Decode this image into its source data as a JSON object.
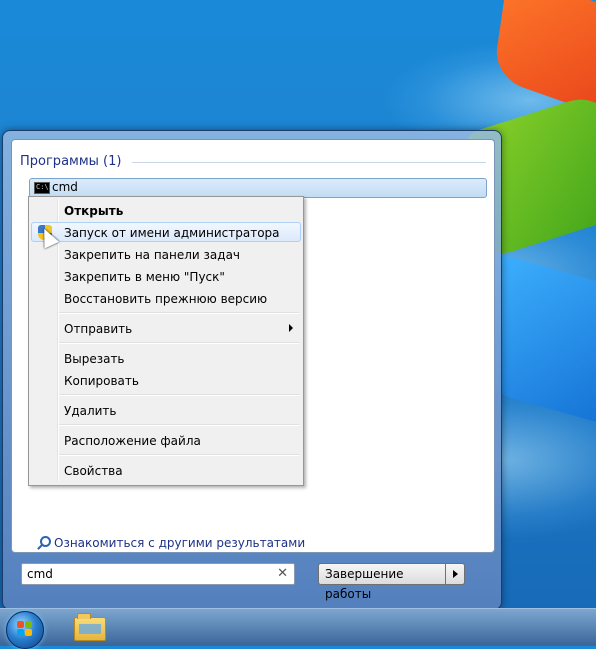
{
  "start_menu": {
    "section_title": "Программы (1)",
    "result": {
      "label": "cmd",
      "icon": "console-icon"
    },
    "more_results_label": "Ознакомиться с другими результатами",
    "search": {
      "value": "cmd",
      "clear_icon": "clear-icon"
    },
    "shutdown_label": "Завершение работы"
  },
  "context_menu": {
    "items": [
      {
        "label": "Открыть",
        "bold": true
      },
      {
        "label": "Запуск от имени администратора",
        "icon": "uac-shield-icon",
        "highlighted": true
      },
      {
        "label": "Закрепить на панели задач"
      },
      {
        "label": "Закрепить в меню \"Пуск\""
      },
      {
        "label": "Восстановить прежнюю версию"
      },
      {
        "label": "Отправить",
        "submenu": true
      },
      {
        "label": "Вырезать"
      },
      {
        "label": "Копировать"
      },
      {
        "label": "Удалить"
      },
      {
        "label": "Расположение файла"
      },
      {
        "label": "Свойства"
      }
    ]
  },
  "taskbar": {
    "start_icon": "windows-start-orb-icon",
    "pinned": [
      {
        "icon": "windows-explorer-folder-icon"
      }
    ]
  },
  "colors": {
    "section_title": "#1e3287",
    "highlight": "#dbe9fb",
    "desktop": "#1f7fcd"
  }
}
